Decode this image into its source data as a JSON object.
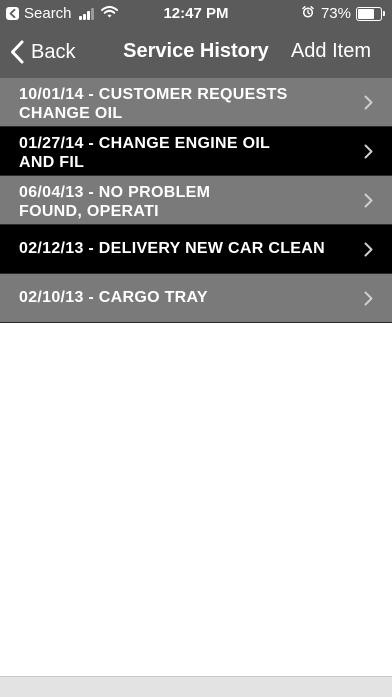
{
  "status_bar": {
    "back_app": "Search",
    "time": "12:47 PM",
    "battery": "73%",
    "battery_level": 0.73
  },
  "nav": {
    "back_label": "Back",
    "title": "Service History",
    "add_label": "Add Item"
  },
  "history": [
    {
      "line1": "10/01/14 - CUSTOMER REQUESTS",
      "line2": "CHANGE OIL",
      "style": "gray"
    },
    {
      "line1": "01/27/14 - CHANGE ENGINE OIL",
      "line2": "AND FIL",
      "style": "black"
    },
    {
      "line1": "06/04/13 - NO PROBLEM",
      "line2": "FOUND, OPERATI",
      "style": "gray"
    },
    {
      "line1": "02/12/13 - DELIVERY NEW CAR CLEAN",
      "line2": "",
      "style": "black"
    },
    {
      "line1": "02/10/13 - CARGO TRAY",
      "line2": "",
      "style": "gray"
    }
  ],
  "icons": {
    "back_app": "chevron-left-icon",
    "signal": "cellular-signal-icon",
    "wifi": "wifi-icon",
    "alarm": "alarm-icon",
    "battery": "battery-icon",
    "nav_back": "chevron-left-icon",
    "row_disclosure": "chevron-right-icon"
  },
  "colors": {
    "bar": "#5b5b5b",
    "row_gray": "#7a7a7a",
    "row_black": "#000000",
    "text": "#ffffff",
    "chevron": "#cfcfcf"
  }
}
